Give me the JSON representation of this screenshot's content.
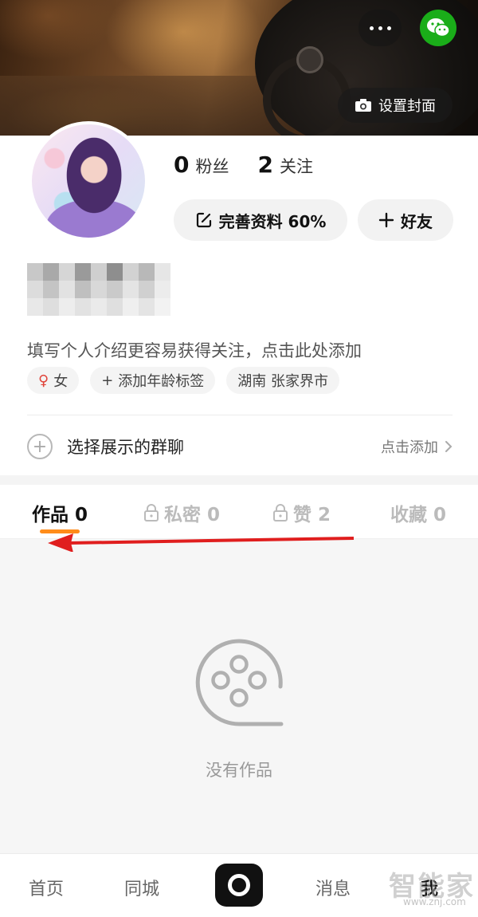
{
  "header": {
    "set_cover_label": "设置封面"
  },
  "profile": {
    "followers_count": "0",
    "followers_label": "粉丝",
    "following_count": "2",
    "following_label": "关注",
    "edit_profile_label": "完善资料 60%",
    "add_friend_label": "好友",
    "bio_placeholder": "填写个人介绍更容易获得关注，点击此处添加",
    "tags": [
      {
        "label": "女"
      },
      {
        "label": "添加年龄标签"
      },
      {
        "label": "湖南 张家界市"
      }
    ],
    "group_chat_label": "选择展示的群聊",
    "group_chat_action": "点击添加"
  },
  "tabs": [
    {
      "label": "作品 0"
    },
    {
      "label": "私密 0"
    },
    {
      "label": "赞 2"
    },
    {
      "label": "收藏 0"
    }
  ],
  "content": {
    "empty_label": "没有作品"
  },
  "nav": {
    "home": "首页",
    "local": "同城",
    "messages": "消息",
    "me": "我"
  },
  "watermark": {
    "text": "智能家",
    "sub": "www.znj.com"
  },
  "colors": {
    "accent": "#ff8c1a",
    "wechat": "#1aad19",
    "annotation_arrow": "#e01e1e"
  },
  "icons": {
    "more": "more-dots-icon",
    "wechat": "wechat-icon",
    "camera": "camera-icon",
    "edit": "edit-icon",
    "plus": "plus-icon",
    "lock": "lock-icon",
    "film": "film-reel-icon",
    "shoot": "shoot-icon"
  }
}
